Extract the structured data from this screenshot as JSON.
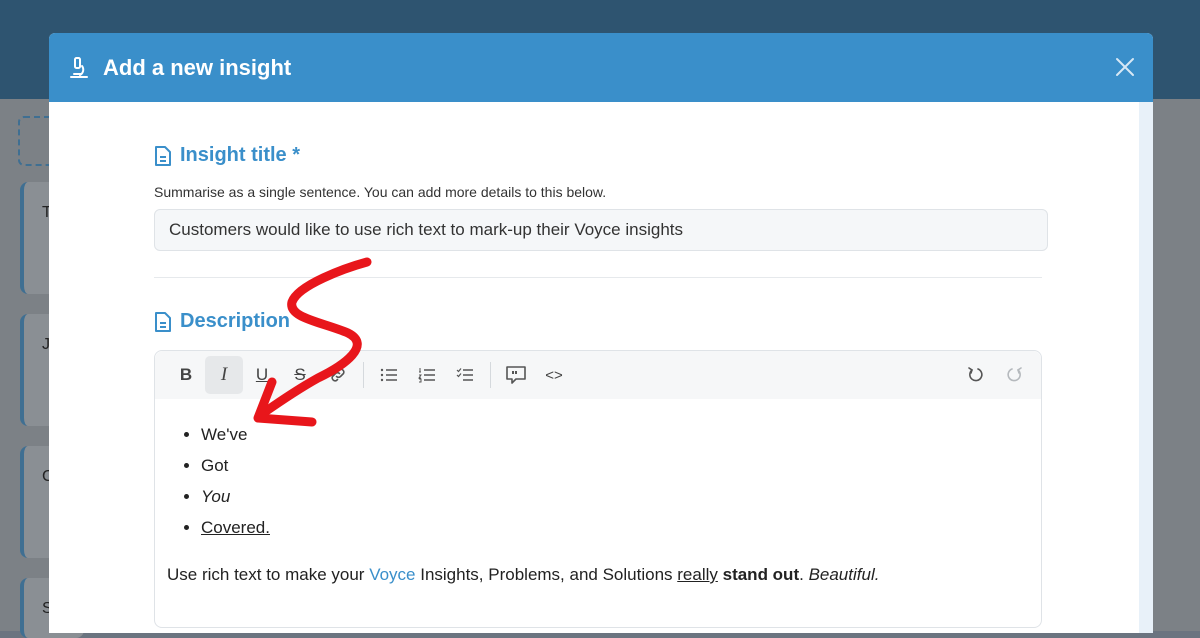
{
  "background": {
    "card_letters": [
      "T",
      "J",
      "C",
      "S"
    ]
  },
  "modal": {
    "title": "Add a new insight",
    "header_icon": "microscope-icon",
    "close_icon": "close-icon",
    "accent_color": "#3a8fca"
  },
  "insight_title": {
    "label": "Insight title *",
    "hint": "Summarise as a single sentence. You can add more details to this below.",
    "value": "Customers would like to use rich text to mark-up their Voyce insights"
  },
  "description": {
    "label": "Description",
    "toolbar": {
      "bold": "B",
      "italic": "I",
      "underline": "U",
      "strike": "S",
      "code": "<>"
    },
    "bullets": [
      "We've",
      "Got",
      "You",
      "Covered."
    ],
    "paragraph": {
      "part1": "Use rich text to make your ",
      "voyce": "Voyce",
      "part2": " Insights, Problems, and Solutions ",
      "really": "really",
      "space1": " ",
      "stand_out": "stand out",
      "part3": ". ",
      "beautiful": "Beautiful."
    }
  }
}
